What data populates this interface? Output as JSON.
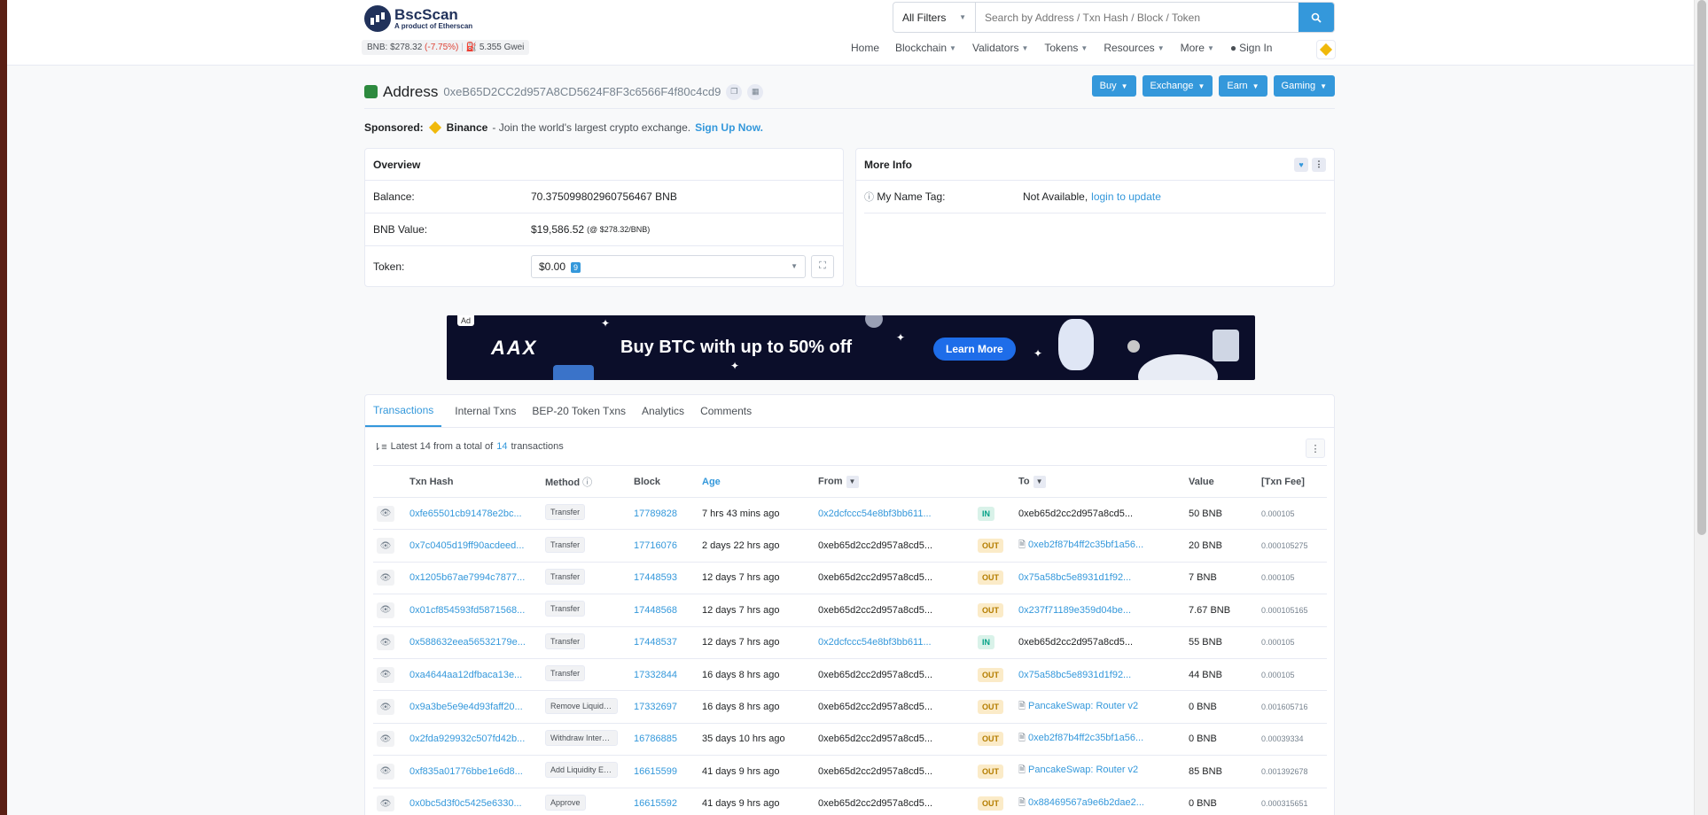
{
  "header": {
    "brand": "BscScan",
    "tagline": "A product of Etherscan",
    "price_label": "BNB: $278.32",
    "price_change": "(-7.75%)",
    "gas": "5.355 Gwei",
    "search_filter": "All Filters",
    "search_placeholder": "Search by Address / Txn Hash / Block / Token",
    "nav": [
      "Home",
      "Blockchain",
      "Validators",
      "Tokens",
      "Resources",
      "More",
      "Sign In"
    ]
  },
  "address": {
    "title": "Address",
    "hash": "0xeB65D2CC2d957A8CD5624F8F3c6566F4f80c4cd9",
    "buttons": [
      "Buy",
      "Exchange",
      "Earn",
      "Gaming"
    ]
  },
  "sponsored": {
    "label": "Sponsored:",
    "name": "Binance",
    "text": "- Join the world's largest crypto exchange.",
    "cta": "Sign Up Now."
  },
  "overview": {
    "title": "Overview",
    "balance_label": "Balance:",
    "balance_value": "70.375099802960756467 BNB",
    "value_label": "BNB Value:",
    "value_amount": "$19,586.52",
    "value_rate": "(@ $278.32/BNB)",
    "token_label": "Token:",
    "token_value": "$0.00",
    "token_count": "9"
  },
  "more_info": {
    "title": "More Info",
    "name_tag_label": "My Name Tag:",
    "name_tag_value": "Not Available,",
    "name_tag_link": "login to update"
  },
  "ad": {
    "tag": "Ad",
    "brand": "AAX",
    "headline": "Buy BTC with up to 50% off",
    "cta": "Learn More"
  },
  "tabs": [
    "Transactions",
    "Internal Txns",
    "BEP-20 Token Txns",
    "Analytics",
    "Comments"
  ],
  "summary": {
    "prefix": "Latest 14 from a total of",
    "count": "14",
    "suffix": "transactions"
  },
  "table": {
    "headers": [
      "Txn Hash",
      "Method",
      "Block",
      "Age",
      "From",
      "To",
      "Value",
      "[Txn Fee]"
    ],
    "rows": [
      {
        "hash": "0xfe65501cb91478e2bc...",
        "method": "Transfer",
        "block": "17789828",
        "age": "7 hrs 43 mins ago",
        "from": "0x2dcfccc54e8bf3bb611...",
        "from_link": true,
        "dir": "IN",
        "to": "0xeb65d2cc2d957a8cd5...",
        "to_link": false,
        "to_contract": false,
        "value": "50 BNB",
        "fee": "0.000105"
      },
      {
        "hash": "0x7c0405d19ff90acdeed...",
        "method": "Transfer",
        "block": "17716076",
        "age": "2 days 22 hrs ago",
        "from": "0xeb65d2cc2d957a8cd5...",
        "from_link": false,
        "dir": "OUT",
        "to": "0xeb2f87b4ff2c35bf1a56...",
        "to_link": true,
        "to_contract": true,
        "value": "20 BNB",
        "fee": "0.000105275"
      },
      {
        "hash": "0x1205b67ae7994c7877...",
        "method": "Transfer",
        "block": "17448593",
        "age": "12 days 7 hrs ago",
        "from": "0xeb65d2cc2d957a8cd5...",
        "from_link": false,
        "dir": "OUT",
        "to": "0x75a58bc5e8931d1f92...",
        "to_link": true,
        "to_contract": false,
        "value": "7 BNB",
        "fee": "0.000105"
      },
      {
        "hash": "0x01cf854593fd5871568...",
        "method": "Transfer",
        "block": "17448568",
        "age": "12 days 7 hrs ago",
        "from": "0xeb65d2cc2d957a8cd5...",
        "from_link": false,
        "dir": "OUT",
        "to": "0x237f71189e359d04be...",
        "to_link": true,
        "to_contract": false,
        "value": "7.67 BNB",
        "fee": "0.000105165"
      },
      {
        "hash": "0x588632eea56532179e...",
        "method": "Transfer",
        "block": "17448537",
        "age": "12 days 7 hrs ago",
        "from": "0x2dcfccc54e8bf3bb611...",
        "from_link": true,
        "dir": "IN",
        "to": "0xeb65d2cc2d957a8cd5...",
        "to_link": false,
        "to_contract": false,
        "value": "55 BNB",
        "fee": "0.000105"
      },
      {
        "hash": "0xa4644aa12dfbaca13e...",
        "method": "Transfer",
        "block": "17332844",
        "age": "16 days 8 hrs ago",
        "from": "0xeb65d2cc2d957a8cd5...",
        "from_link": false,
        "dir": "OUT",
        "to": "0x75a58bc5e8931d1f92...",
        "to_link": true,
        "to_contract": false,
        "value": "44 BNB",
        "fee": "0.000105"
      },
      {
        "hash": "0x9a3be5e9e4d93faff20...",
        "method": "Remove Liquidity...",
        "block": "17332697",
        "age": "16 days 8 hrs ago",
        "from": "0xeb65d2cc2d957a8cd5...",
        "from_link": false,
        "dir": "OUT",
        "to": "PancakeSwap: Router v2",
        "to_link": true,
        "to_contract": true,
        "value": "0 BNB",
        "fee": "0.001605716"
      },
      {
        "hash": "0x2fda929932c507fd42b...",
        "method": "Withdraw Interes...",
        "block": "16786885",
        "age": "35 days 10 hrs ago",
        "from": "0xeb65d2cc2d957a8cd5...",
        "from_link": false,
        "dir": "OUT",
        "to": "0xeb2f87b4ff2c35bf1a56...",
        "to_link": true,
        "to_contract": true,
        "value": "0 BNB",
        "fee": "0.00039334"
      },
      {
        "hash": "0xf835a01776bbe1e6d8...",
        "method": "Add Liquidity ET...",
        "block": "16615599",
        "age": "41 days 9 hrs ago",
        "from": "0xeb65d2cc2d957a8cd5...",
        "from_link": false,
        "dir": "OUT",
        "to": "PancakeSwap: Router v2",
        "to_link": true,
        "to_contract": true,
        "value": "85 BNB",
        "fee": "0.001392678"
      },
      {
        "hash": "0x0bc5d3f0c5425e6330...",
        "method": "Approve",
        "block": "16615592",
        "age": "41 days 9 hrs ago",
        "from": "0xeb65d2cc2d957a8cd5...",
        "from_link": false,
        "dir": "OUT",
        "to": "0x88469567a9e6b2dae2...",
        "to_link": true,
        "to_contract": true,
        "value": "0 BNB",
        "fee": "0.000315651"
      }
    ]
  }
}
